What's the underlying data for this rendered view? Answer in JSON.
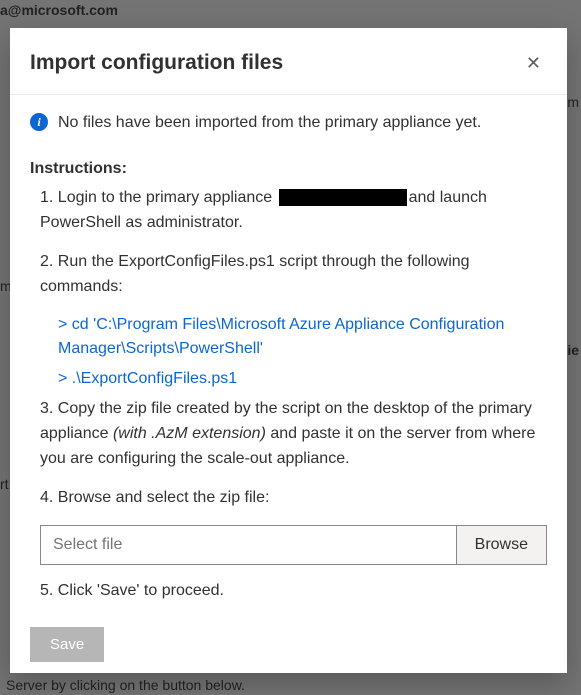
{
  "bg": {
    "top": "a@microsoft.com",
    "right1": "om",
    "right2": "ie",
    "left1": "m",
    "left2": "rt",
    "bottom": "Server by clicking on the button below."
  },
  "dialog": {
    "title": "Import configuration files",
    "close_label": "✕",
    "info_icon": "i",
    "info_text": "No files have been imported from the primary appliance yet.",
    "instructions_heading": "Instructions:",
    "step1_a": "1. Login to the primary appliance ",
    "step1_b": "and launch PowerShell as administrator.",
    "step2": "2. Run the ExportConfigFiles.ps1 script through the following commands:",
    "cmd1": "> cd 'C:\\Program Files\\Microsoft Azure Appliance Configuration Manager\\Scripts\\PowerShell'",
    "cmd2": "> .\\ExportConfigFiles.ps1",
    "step3_a": "3. Copy the zip file created by the script on the desktop of the primary appliance ",
    "step3_italic": "(with .AzM extension)",
    "step3_b": " and paste it on the server from where you are configuring the scale-out appliance.",
    "step4": "4. Browse and select the zip file:",
    "file_placeholder": "Select file",
    "browse_label": "Browse",
    "step5": "5. Click 'Save' to proceed.",
    "save_label": "Save"
  }
}
